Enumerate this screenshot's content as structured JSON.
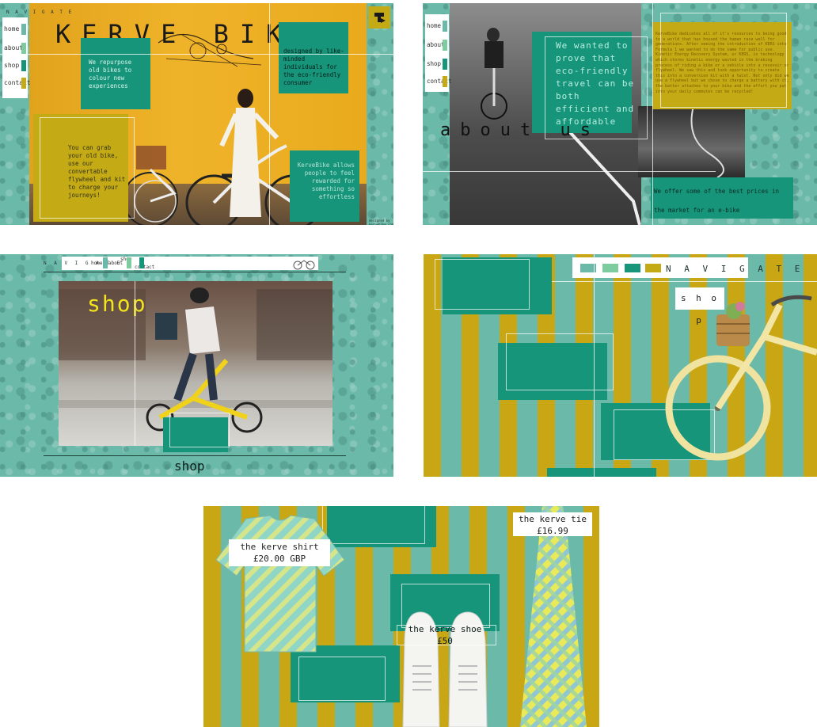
{
  "slide1": {
    "nav_label": "N A V I G A T E",
    "nav_items": [
      "home",
      "about",
      "shop",
      "contact"
    ],
    "brand": "KERVE BIKE",
    "text_repurpose": "We repurpose old bikes to colour new experiences",
    "text_designed": "designed by like-minded individuals for the eco-friendly consumer",
    "text_grab": "You can grab your old bike, use our convertable flywheel and kit to charge your journeys!",
    "text_allows": "KerveBike allows people to feel rewarded for something so effortless",
    "credit": "designed by kervebike.com"
  },
  "slide2": {
    "nav_items": [
      "home",
      "about",
      "shop",
      "contact"
    ],
    "about": "about us",
    "heading": "We wanted to prove that eco-friendly travel can be both efficient and affordable",
    "body": "KerveBike dedicates all of it's resources to being good to a world that has housed the human race well for generations. After seeing the introduction of KERS into Formula 1 we wanted to do the same for public use. Kinetic Energy Recovery System, or KERS, is technology which stores kinetic energy wasted in the braking process of riding a bike or a vehicle into a resovoir or flywheel. We saw this and took opportunity to create this into a conversion kit with a twist. Not only did we use a flywheel but we chose to charge a battery with it, the batter attaches to your bike and the effort you put into your daily commutes can be recycled!",
    "prices": "We offer some of the best prices in the market for an  e-bike"
  },
  "slide3": {
    "nav_label": "N A V I G A T E",
    "nav_items": [
      "home",
      "about",
      "shop",
      "contact"
    ],
    "shop_overlay": "shop",
    "shop_caption": "shop"
  },
  "slide4": {
    "nav_label": "N A V I G A T E",
    "shop_chip": "s h o p"
  },
  "slide5": {
    "shirt_name": "the kerve shirt",
    "shirt_price": "£20.00 GBP",
    "tie_name": "the kerve tie",
    "tie_price": "£16.99",
    "shoe_name": "the kerve shoe",
    "shoe_price": "£50"
  },
  "colors": {
    "teal": "#6bb9a8",
    "green": "#16957a",
    "mustard": "#c4aa14",
    "yellow_wall": "#efb32a"
  }
}
